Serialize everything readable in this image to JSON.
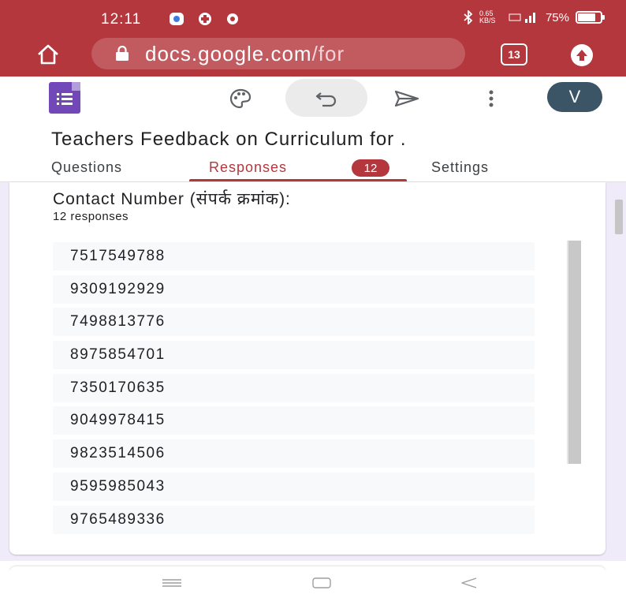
{
  "status_bar": {
    "time": "12:11",
    "network_speed": "0.65 KB/S",
    "battery": "75%"
  },
  "browser": {
    "url_host": "docs.google.com",
    "url_path": "/for",
    "tab_count": "13"
  },
  "toolbar": {
    "avatar_letter": "V"
  },
  "form": {
    "title": "Teachers Feedback on Curriculum for ."
  },
  "tabs": {
    "questions": "Questions",
    "responses": "Responses",
    "responses_badge": "12",
    "settings": "Settings"
  },
  "question": {
    "title": "Contact Number (संपर्क क्रमांक):",
    "response_count": "12 responses"
  },
  "responses": [
    "7517549788",
    "9309192929",
    "7498813776",
    "8975854701",
    "7350170635",
    "9049978415",
    "9823514506",
    "9595985043",
    "9765489336"
  ],
  "colors": {
    "chrome": "#b3373d",
    "forms_purple": "#7248b9",
    "content_bg": "#f0ebf8"
  },
  "icons": [
    "home-icon",
    "lock-icon",
    "palette-icon",
    "undo-icon",
    "send-icon",
    "more-vert-icon",
    "menu-icon",
    "square-icon",
    "back-icon"
  ]
}
